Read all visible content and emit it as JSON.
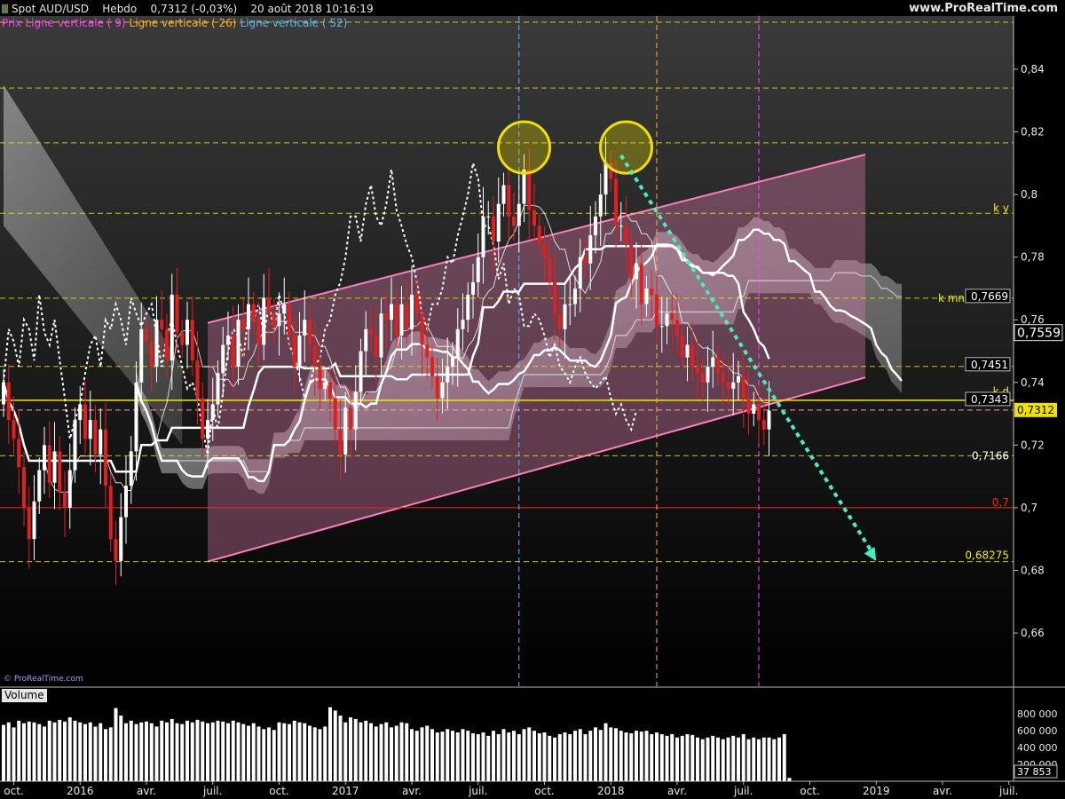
{
  "header": {
    "instrument": "Spot AUD/USD",
    "period": "Hebdo",
    "price_change": "0,7312 (-0,03%)",
    "datetime": "20 août 2018 10:16:19",
    "site": "www.ProRealTime.com"
  },
  "legend": {
    "items": [
      {
        "label": "Prix",
        "color": "#ff40ff"
      },
      {
        "label": "Ligne verticale ( 9)",
        "color": "#ff40ff"
      },
      {
        "label": "Ligne verticale ( 26)",
        "color": "#ffb030"
      },
      {
        "label": "Ligne verticale ( 52)",
        "color": "#58b8ff"
      }
    ]
  },
  "copyright": "© ProRealTime.com",
  "volume_title": "Volume",
  "colors": {
    "background": "#000000",
    "candle_up": "#ffffff",
    "candle_down": "#e02020",
    "channel_line": "#ff7fbf",
    "channel_fill": "#d77ca8",
    "cloud": "#cfcfcf",
    "level_line": "#e6e600",
    "arrow": "#40f0c0",
    "circle": "#f0e000",
    "kd_line": "#ffe000",
    "red_level": "#ff2020",
    "last_price_bg": "#f0e000"
  },
  "chart_data": {
    "type": "candlestick",
    "ylim": [
      0.643,
      0.857
    ],
    "y_ticks": [
      "0,84",
      "0,82",
      "0,8",
      "0,78",
      "0,76",
      "0,74",
      "0,72",
      "0,7",
      "0,68",
      "0,66"
    ],
    "y_tick_values": [
      0.84,
      0.82,
      0.8,
      0.78,
      0.76,
      0.74,
      0.72,
      0.7,
      0.68,
      0.66
    ],
    "x_labels": [
      "oct.",
      "2016",
      "avr.",
      "juil.",
      "oct.",
      "2017",
      "avr.",
      "juil.",
      "oct.",
      "2018",
      "avr.",
      "juil.",
      "oct.",
      "2019",
      "avr.",
      "juil."
    ],
    "x_label_week_index": [
      2,
      15,
      28,
      41,
      54,
      67,
      80,
      93,
      106,
      119,
      132,
      145,
      158,
      171,
      184,
      197
    ],
    "weeks_total": 207,
    "first_close": 0.733,
    "last_close": 0.7312,
    "closes": [
      0.74,
      0.728,
      0.722,
      0.713,
      0.7,
      0.69,
      0.702,
      0.712,
      0.72,
      0.708,
      0.718,
      0.705,
      0.7,
      0.712,
      0.728,
      0.733,
      0.722,
      0.728,
      0.717,
      0.725,
      0.707,
      0.69,
      0.683,
      0.697,
      0.707,
      0.718,
      0.74,
      0.757,
      0.753,
      0.745,
      0.76,
      0.757,
      0.747,
      0.768,
      0.756,
      0.752,
      0.76,
      0.747,
      0.735,
      0.722,
      0.728,
      0.733,
      0.743,
      0.752,
      0.755,
      0.745,
      0.76,
      0.757,
      0.765,
      0.76,
      0.752,
      0.767,
      0.762,
      0.758,
      0.762,
      0.765,
      0.755,
      0.745,
      0.755,
      0.76,
      0.752,
      0.745,
      0.738,
      0.74,
      0.735,
      0.725,
      0.717,
      0.732,
      0.725,
      0.737,
      0.75,
      0.757,
      0.755,
      0.748,
      0.762,
      0.76,
      0.765,
      0.755,
      0.765,
      0.757,
      0.768,
      0.762,
      0.752,
      0.748,
      0.742,
      0.735,
      0.74,
      0.745,
      0.748,
      0.757,
      0.76,
      0.768,
      0.772,
      0.78,
      0.793,
      0.793,
      0.785,
      0.797,
      0.803,
      0.793,
      0.79,
      0.797,
      0.808,
      0.795,
      0.79,
      0.784,
      0.78,
      0.772,
      0.762,
      0.757,
      0.765,
      0.765,
      0.77,
      0.78,
      0.778,
      0.787,
      0.793,
      0.8,
      0.81,
      0.805,
      0.79,
      0.79,
      0.784,
      0.773,
      0.778,
      0.765,
      0.77,
      0.768,
      0.758,
      0.758,
      0.762,
      0.76,
      0.755,
      0.748,
      0.752,
      0.745,
      0.743,
      0.74,
      0.745,
      0.748,
      0.743,
      0.74,
      0.738,
      0.74,
      0.742,
      0.735,
      0.73,
      0.733,
      0.728,
      0.725,
      0.731
    ],
    "channel": {
      "upper": {
        "x0_week": 40,
        "y0": 0.759,
        "x1_week": 275,
        "y1": 0.857
      },
      "lower": {
        "x0_week": 40,
        "y0": 0.6828,
        "x1_week": 275,
        "y1": 0.79
      },
      "fill_end_week": 275
    },
    "levels": [
      {
        "value": 0.855,
        "label": ""
      },
      {
        "value": 0.834,
        "label": ""
      },
      {
        "value": 0.8165,
        "label": ""
      },
      {
        "value": 0.794,
        "label": "k y"
      },
      {
        "value": 0.7669,
        "label": "k mn"
      },
      {
        "value": 0.7451,
        "label": ""
      },
      {
        "value": 0.7343,
        "label": "k d"
      },
      {
        "value": 0.7166,
        "label": ""
      },
      {
        "value": 0.6828,
        "label": "0,68275"
      }
    ],
    "level_labels": {
      "k_y": "k y",
      "k_mn": "k mn",
      "k_mn_value": "0,7669",
      "v_7451": "0,7451",
      "k_d": "k d",
      "v_7343": "0,7343",
      "v_7166": "0,7166",
      "v_68275": "0,68275",
      "red_level_label": "0,7",
      "last_price": "0,7312",
      "ichimoku_last": "0,7559"
    },
    "red_level": 0.7,
    "vertical_lines": [
      {
        "week": 101,
        "color": "#58b8ff"
      },
      {
        "week": 128,
        "color": "#ffb030"
      },
      {
        "week": 148,
        "color": "#ff40ff"
      }
    ],
    "circles": [
      {
        "week": 102,
        "value": 0.815
      },
      {
        "week": 122,
        "value": 0.815
      }
    ],
    "arrow": {
      "x0_week": 121,
      "y0": 0.8125,
      "x1_week": 171,
      "y1": 0.683
    },
    "volume": {
      "ticks": [
        "800 000",
        "600 000",
        "400 000",
        "200 000"
      ],
      "tick_values": [
        800000,
        600000,
        400000,
        200000
      ],
      "max": 950000,
      "last_label": "37 853",
      "values": [
        670,
        700,
        640,
        720,
        690,
        710,
        700,
        680,
        650,
        720,
        700,
        730,
        710,
        760,
        720,
        700,
        680,
        700,
        650,
        690,
        620,
        640,
        870,
        780,
        690,
        720,
        680,
        700,
        710,
        690,
        650,
        720,
        700,
        740,
        690,
        680,
        720,
        700,
        730,
        710,
        690,
        700,
        720,
        710,
        690,
        720,
        700,
        680,
        660,
        690,
        650,
        620,
        640,
        610,
        700,
        690,
        680,
        720,
        700,
        690,
        660,
        640,
        620,
        650,
        880,
        840,
        780,
        700,
        760,
        740,
        700,
        720,
        690,
        650,
        680,
        700,
        640,
        660,
        700,
        690,
        620,
        600,
        640,
        660,
        620,
        580,
        590,
        620,
        600,
        580,
        620,
        600,
        570,
        560,
        580,
        540,
        600,
        560,
        620,
        580,
        600,
        560,
        620,
        640,
        600,
        570,
        580,
        540,
        520,
        560,
        580,
        560,
        600,
        620,
        560,
        600,
        640,
        610,
        690,
        640,
        630,
        600,
        580,
        570,
        600,
        590,
        600,
        560,
        580,
        560,
        540,
        560,
        520,
        540,
        560,
        550,
        520,
        500,
        520,
        540,
        520,
        500,
        520,
        540,
        520,
        560,
        500,
        520,
        500,
        520,
        520,
        500,
        520,
        560,
        40
      ]
    }
  }
}
